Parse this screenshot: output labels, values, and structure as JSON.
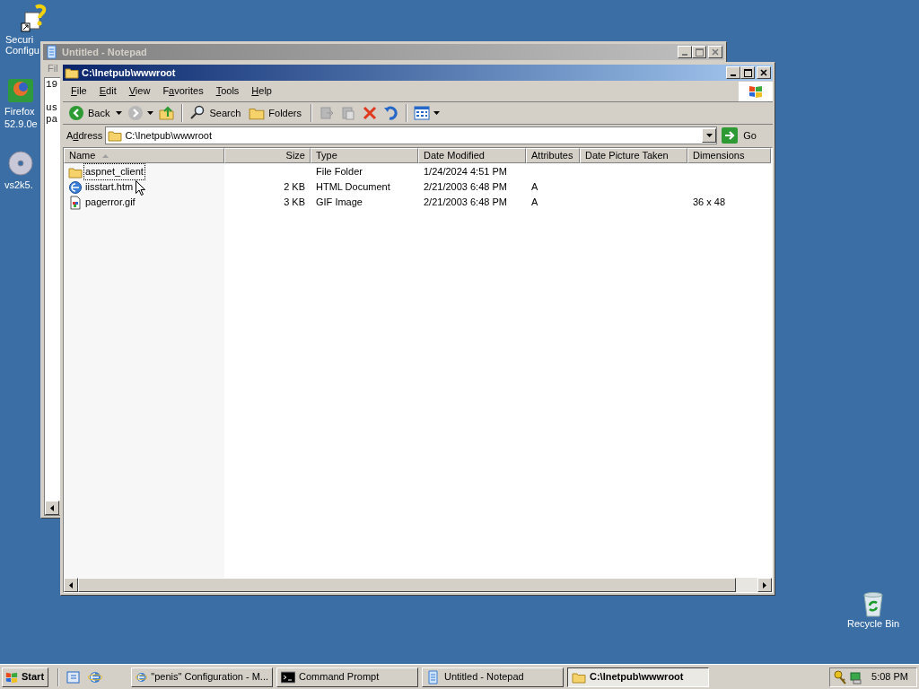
{
  "desktop_icons": [
    {
      "kind": "security",
      "lines": [
        "Securi",
        "Configu"
      ]
    },
    {
      "kind": "firefox",
      "lines": [
        "Firefox",
        "52.9.0e"
      ]
    },
    {
      "kind": "disc",
      "lines": [
        "vs2k5."
      ]
    }
  ],
  "recycle_bin": {
    "kind": "recycle",
    "lines": [
      "Recycle Bin"
    ]
  },
  "notepad": {
    "title": "Untitled - Notepad",
    "active": false,
    "menu": [
      "Fil"
    ],
    "lines": [
      "19",
      "us",
      "pa"
    ]
  },
  "explorer": {
    "title": "C:\\Inetpub\\wwwroot",
    "active": true,
    "menu": [
      {
        "key": "F",
        "post": "ile"
      },
      {
        "key": "E",
        "post": "dit"
      },
      {
        "key": "V",
        "post": "iew"
      },
      {
        "pre": "F",
        "key": "a",
        "post": "vorites"
      },
      {
        "key": "T",
        "post": "ools"
      },
      {
        "key": "H",
        "post": "elp"
      }
    ],
    "toolbar": [
      {
        "kind": "back",
        "label": "Back",
        "disabled": false
      },
      {
        "kind": "forward",
        "disabled": true
      },
      {
        "kind": "up",
        "disabled": false
      },
      {
        "kind": "sep"
      },
      {
        "kind": "search",
        "label": "Search",
        "disabled": false
      },
      {
        "kind": "folders",
        "label": "Folders",
        "disabled": false
      },
      {
        "kind": "sep"
      },
      {
        "kind": "move",
        "disabled": true
      },
      {
        "kind": "copy",
        "disabled": true
      },
      {
        "kind": "delete",
        "disabled": false
      },
      {
        "kind": "undo",
        "disabled": false
      },
      {
        "kind": "sep"
      },
      {
        "kind": "views",
        "disabled": false
      }
    ],
    "address": {
      "label": {
        "pre": "A",
        "key": "d",
        "post": "dress"
      },
      "value": "C:\\Inetpub\\wwwroot",
      "go": "Go"
    },
    "columns": [
      {
        "label": "Name",
        "sorted": true
      },
      {
        "label": "Size",
        "sorted": false
      },
      {
        "label": "Type",
        "sorted": false
      },
      {
        "label": "Date Modified",
        "sorted": false
      },
      {
        "label": "Attributes",
        "sorted": false
      },
      {
        "label": "Date Picture Taken",
        "sorted": false
      },
      {
        "label": "Dimensions",
        "sorted": false
      }
    ],
    "rows": [
      {
        "kind": "folder",
        "focused": true,
        "cells": [
          "aspnet_client",
          "",
          "File Folder",
          "1/24/2024 4:51 PM",
          "",
          "",
          ""
        ]
      },
      {
        "kind": "html",
        "focused": false,
        "cells": [
          "iisstart.htm",
          "2 KB",
          "HTML Document",
          "2/21/2003 6:48 PM",
          "A",
          "",
          ""
        ]
      },
      {
        "kind": "gif",
        "focused": false,
        "cells": [
          "pagerror.gif",
          "3 KB",
          "GIF Image",
          "2/21/2003 6:48 PM",
          "A",
          "",
          "36 x 48"
        ]
      }
    ]
  },
  "taskbar": {
    "start": "Start",
    "quick_launch": [
      {
        "kind": "desktop"
      },
      {
        "kind": "ie"
      }
    ],
    "tasks": [
      {
        "kind": "ie",
        "label": "\"penis\" Configuration - M...",
        "selected": false
      },
      {
        "kind": "cmd",
        "label": "Command Prompt",
        "selected": false
      },
      {
        "kind": "notepad",
        "label": "Untitled - Notepad",
        "selected": false
      },
      {
        "kind": "folder",
        "label": "C:\\Inetpub\\wwwroot",
        "selected": true
      }
    ],
    "tray": [
      {
        "kind": "security"
      },
      {
        "kind": "network"
      }
    ],
    "clock": "5:08 PM"
  }
}
